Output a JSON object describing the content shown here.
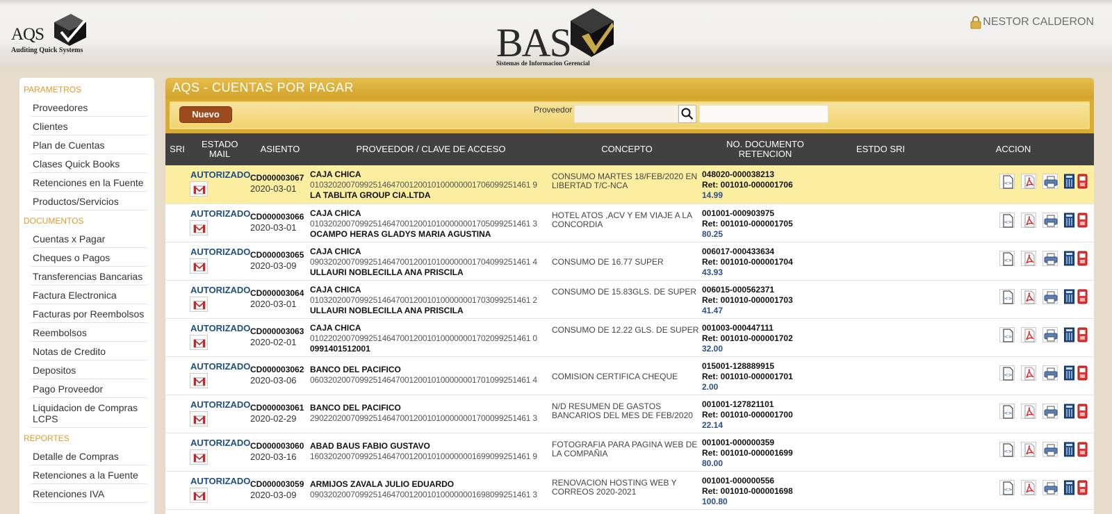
{
  "header": {
    "aqs_logo_text": "AQS",
    "aqs_logo_sub": "Auditing Quick Systems",
    "bas_logo_text": "BAS",
    "bas_logo_sub": "Sistemas de Informacion Gerencial",
    "user_name": "NESTOR CALDERON"
  },
  "sidebar": {
    "sections": [
      {
        "title": "PARAMETROS",
        "items": [
          "Proveedores",
          "Clientes",
          "Plan de Cuentas",
          "Clases Quick Books",
          "Retenciones en la Fuente",
          "Productos/Servicios"
        ]
      },
      {
        "title": "DOCUMENTOS",
        "items": [
          "Cuentas x Pagar",
          "Cheques o Pagos",
          "Transferencias Bancarias",
          "Factura Electronica",
          "Facturas por Reembolsos",
          "Reembolsos",
          "Notas de Credito",
          "Depositos",
          "Pago Proveedor",
          "Liquidacion de Compras LCPS"
        ]
      },
      {
        "title": "REPORTES",
        "items": [
          "Detalle de Compras",
          "Retenciones a la Fuente",
          "Retenciones IVA"
        ]
      }
    ]
  },
  "panel": {
    "title": "AQS - CUENTAS POR PAGAR",
    "nuevo_label": "Nuevo",
    "proveedor_label": "Proveedor"
  },
  "table": {
    "columns": [
      "SRI",
      "ESTADO MAIL",
      "ASIENTO",
      "PROVEEDOR / CLAVE DE ACCESO",
      "CONCEPTO",
      "NO. DOCUMENTO RETENCION",
      "ESTDO SRI",
      "ACCION"
    ],
    "rows": [
      {
        "estado": "AUTORIZADO",
        "asiento": "CD000003067",
        "fecha": "2020-03-01",
        "proveedor": "CAJA CHICA",
        "clave": "0103202007099251464700120010100000001706099251461 9",
        "extra": "LA TABLITA GROUP CIA.LTDA",
        "concepto": "CONSUMO MARTES 18/FEB/2020 EN LIBERTAD T/C-NCA",
        "doc": "048020-000038213",
        "ret": "Ret: 001010-000001706",
        "valor": "14.99"
      },
      {
        "estado": "AUTORIZADO",
        "asiento": "CD000003066",
        "fecha": "2020-03-01",
        "proveedor": "CAJA CHICA",
        "clave": "0103202007099251464700120010100000001705099251461 3",
        "extra": "OCAMPO HERAS GLADYS MARIA AGUSTINA",
        "concepto": "HOTEL ATOS ,ACV Y EM VIAJE A LA CONCORDIA",
        "doc": "001001-000903975",
        "ret": "Ret: 001010-000001705",
        "valor": "80.25"
      },
      {
        "estado": "AUTORIZADO",
        "asiento": "CD000003065",
        "fecha": "2020-03-09",
        "proveedor": "CAJA CHICA",
        "clave": "0903202007099251464700120010100000001704099251461 4",
        "extra": "ULLAURI NOBLECILLA ANA PRISCILA",
        "concepto": "CONSUMO DE 16.77 SUPER",
        "doc": "006017-000433634",
        "ret": "Ret: 001010-000001704",
        "valor": "43.93"
      },
      {
        "estado": "AUTORIZADO",
        "asiento": "CD000003064",
        "fecha": "2020-03-01",
        "proveedor": "CAJA CHICA",
        "clave": "0103202007099251464700120010100000001703099251461 2",
        "extra": "ULLAURI NOBLECILLA ANA PRISCILA",
        "concepto": "CONSUMO DE 15.83GLS. DE SUPER",
        "doc": "006015-000562371",
        "ret": "Ret: 001010-000001703",
        "valor": "41.47"
      },
      {
        "estado": "AUTORIZADO",
        "asiento": "CD000003063",
        "fecha": "2020-02-01",
        "proveedor": "CAJA CHICA",
        "clave": "0102202007099251464700120010100000001702099251461 0",
        "extra": "0991401512001",
        "concepto": "CONSUMO DE 12.22 GLS. DE SUPER",
        "doc": "001003-000447111",
        "ret": "Ret: 001010-000001702",
        "valor": "32.00"
      },
      {
        "estado": "AUTORIZADO",
        "asiento": "CD000003062",
        "fecha": "2020-03-06",
        "proveedor": "BANCO DEL PACIFICO",
        "clave": "0603202007099251464700120010100000001701099251461 4",
        "extra": "",
        "concepto": "COMISION CERTIFICA CHEQUE",
        "doc": "015001-128889915",
        "ret": "Ret: 001010-000001701",
        "valor": "2.00"
      },
      {
        "estado": "AUTORIZADO",
        "asiento": "CD000003061",
        "fecha": "2020-02-29",
        "proveedor": "BANCO DEL PACIFICO",
        "clave": "2902202007099251464700120010100000001700099251461 3",
        "extra": "",
        "concepto": "N/D RESUMEN DE GASTOS BANCARIOS DEL MES DE FEB/2020",
        "doc": "001001-127821101",
        "ret": "Ret: 001010-000001700",
        "valor": "22.14"
      },
      {
        "estado": "AUTORIZADO",
        "asiento": "CD000003060",
        "fecha": "2020-03-16",
        "proveedor": "ABAD BAUS FABIO GUSTAVO",
        "clave": "1603202007099251464700120010100000001699099251461 9",
        "extra": "",
        "concepto": "FOTOGRAFIA PARA PAGINA WEB DE LA COMPAÑIA",
        "doc": "001001-000000359",
        "ret": "Ret: 001010-000001699",
        "valor": "80.00"
      },
      {
        "estado": "AUTORIZADO",
        "asiento": "CD000003059",
        "fecha": "2020-03-09",
        "proveedor": "ARMIJOS ZAVALA JULIO EDUARDO",
        "clave": "0903202007099251464700120010100000001698099251461 3",
        "extra": "",
        "concepto": "RENOVACION HOSTING WEB Y CORREOS 2020-2021",
        "doc": "001001-000000556",
        "ret": "Ret: 001010-000001698",
        "valor": "100.80"
      }
    ]
  },
  "colors": {
    "accent_gold": "#d9ab30",
    "button_brown": "#9c4a1e",
    "selected_row": "#fbeea0",
    "section_orange": "#e39a2a",
    "status_blue": "#1c4e8a"
  },
  "icons": [
    "lock-icon",
    "search-icon",
    "mail-icon",
    "xml-icon",
    "pdf-icon",
    "print-icon",
    "calculator-icon",
    "delete-icon"
  ]
}
